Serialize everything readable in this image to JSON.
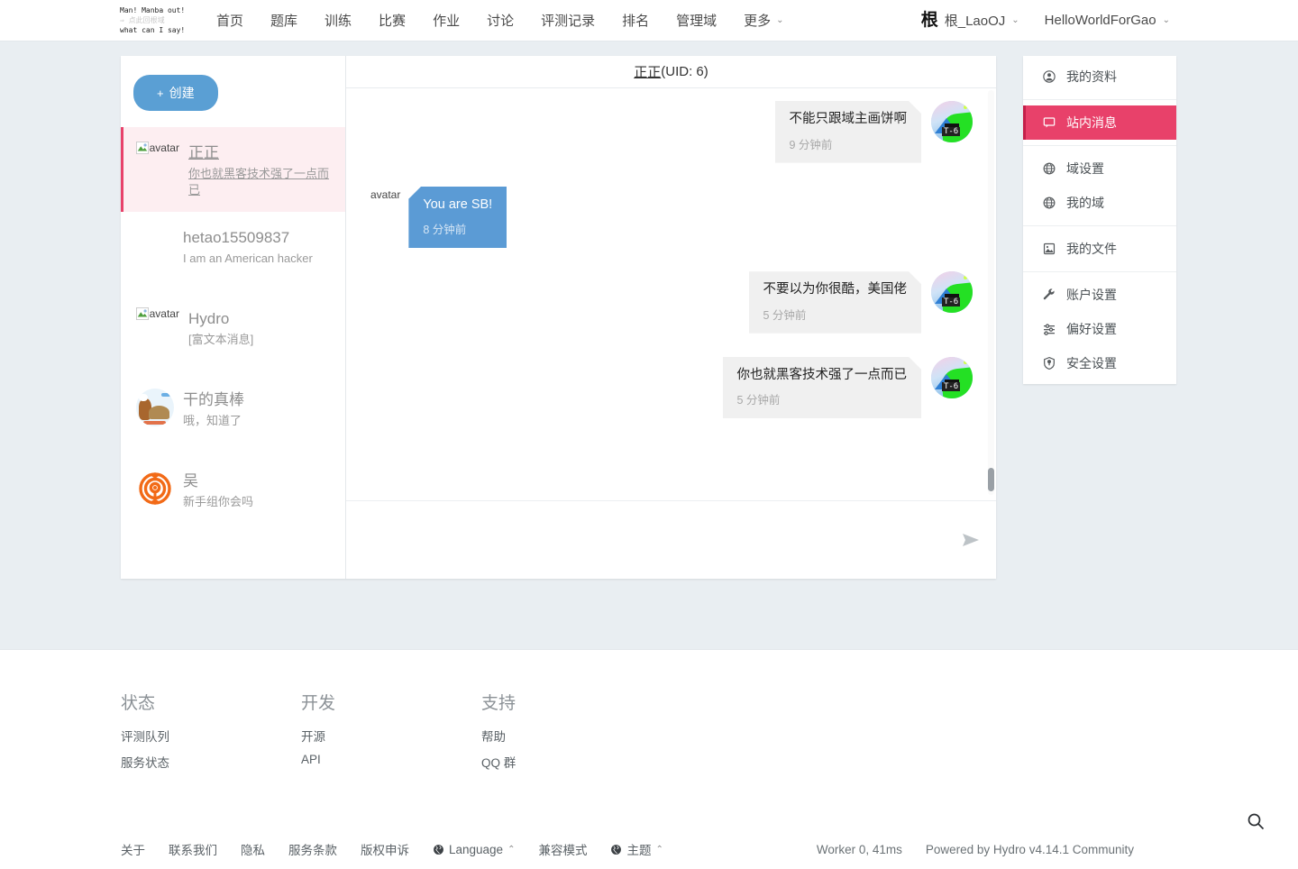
{
  "nav": {
    "logo": {
      "line1": "Man! Manba out!",
      "line2": "⇒ 点此回根域",
      "line3": "what can I say!"
    },
    "items": [
      {
        "label": "首页",
        "name": "nav-home"
      },
      {
        "label": "题库",
        "name": "nav-problemset"
      },
      {
        "label": "训练",
        "name": "nav-training"
      },
      {
        "label": "比赛",
        "name": "nav-contest"
      },
      {
        "label": "作业",
        "name": "nav-homework"
      },
      {
        "label": "讨论",
        "name": "nav-discussion"
      },
      {
        "label": "评测记录",
        "name": "nav-records"
      },
      {
        "label": "排名",
        "name": "nav-ranking"
      },
      {
        "label": "管理域",
        "name": "nav-manage-domain"
      },
      {
        "label": "更多",
        "name": "nav-more",
        "caret": true
      }
    ],
    "user": {
      "avatar_char": "根",
      "label": "根_LaoOJ",
      "caret": "⌄"
    },
    "domain": {
      "label": "HelloWorldForGao",
      "caret": "⌄"
    }
  },
  "messenger": {
    "create_button": {
      "plus": "+",
      "label": "创建"
    },
    "conversations": [
      {
        "name": "正正",
        "preview": "你也就黑客技术强了一点而已",
        "avatar": "broken",
        "avatar_alt": "avatar",
        "active": true
      },
      {
        "name": "hetao15509837",
        "preview": "I am an American hacker",
        "avatar": "none",
        "avatar_alt": "",
        "active": false
      },
      {
        "name": "Hydro",
        "preview": "[富文本消息]",
        "avatar": "broken",
        "avatar_alt": "avatar",
        "active": false
      },
      {
        "name": "干的真棒",
        "preview": "哦，知道了",
        "avatar": "ganhuo",
        "avatar_alt": "",
        "active": false
      },
      {
        "name": "吴",
        "preview": "新手组你会吗",
        "avatar": "wu",
        "avatar_alt": "",
        "active": false
      }
    ],
    "chat_header": {
      "username": "正正",
      "uid": "(UID: 6)"
    },
    "messages": [
      {
        "side": "out",
        "text": "不能只跟域主画饼啊",
        "time": "9 分钟前",
        "avatar": "t6",
        "avatar_alt": ""
      },
      {
        "side": "in",
        "text": "You are SB!",
        "time": "8 分钟前",
        "avatar": "broken",
        "avatar_alt": "avatar"
      },
      {
        "side": "out",
        "text": "不要以为你很酷，美国佬",
        "time": "5 分钟前",
        "avatar": "t6",
        "avatar_alt": ""
      },
      {
        "side": "out",
        "text": "你也就黑客技术强了一点而已",
        "time": "5 分钟前",
        "avatar": "t6",
        "avatar_alt": ""
      }
    ],
    "input": {
      "value": "",
      "placeholder": ""
    },
    "send_icon": "send-icon"
  },
  "side_menu": {
    "groups": [
      [
        {
          "label": "我的资料",
          "icon": "user-icon",
          "name": "sidebar-item-profile",
          "active": false
        }
      ],
      [
        {
          "label": "站内消息",
          "icon": "message-icon",
          "name": "sidebar-item-messages",
          "active": true
        }
      ],
      [
        {
          "label": "域设置",
          "icon": "globe-icon",
          "name": "sidebar-item-domain-settings",
          "active": false
        },
        {
          "label": "我的域",
          "icon": "globe-icon",
          "name": "sidebar-item-my-domains",
          "active": false
        }
      ],
      [
        {
          "label": "我的文件",
          "icon": "image-file-icon",
          "name": "sidebar-item-my-files",
          "active": false
        }
      ],
      [
        {
          "label": "账户设置",
          "icon": "wrench-icon",
          "name": "sidebar-item-account-settings",
          "active": false
        },
        {
          "label": "偏好设置",
          "icon": "sliders-icon",
          "name": "sidebar-item-preferences",
          "active": false
        },
        {
          "label": "安全设置",
          "icon": "shield-icon",
          "name": "sidebar-item-security",
          "active": false
        }
      ]
    ],
    "accent": "#e8416a"
  },
  "footer": {
    "columns": [
      {
        "title": "状态",
        "links": [
          "评测队列",
          "服务状态"
        ]
      },
      {
        "title": "开发",
        "links": [
          "开源",
          "API"
        ]
      },
      {
        "title": "支持",
        "links": [
          "帮助",
          "QQ 群"
        ]
      }
    ],
    "bottom_links": [
      {
        "label": "关于",
        "icon": ""
      },
      {
        "label": "联系我们",
        "icon": ""
      },
      {
        "label": "隐私",
        "icon": ""
      },
      {
        "label": "服务条款",
        "icon": ""
      },
      {
        "label": "版权申诉",
        "icon": ""
      },
      {
        "label": "Language",
        "icon": "globe-icon",
        "caret": "⌃"
      },
      {
        "label": "兼容模式",
        "icon": ""
      },
      {
        "label": "主题",
        "icon": "globe-icon",
        "caret": "⌃"
      }
    ],
    "worker": "Worker 0, 41ms",
    "powered": "Powered by Hydro v4.14.1 Community",
    "search_icon": "search-icon"
  }
}
